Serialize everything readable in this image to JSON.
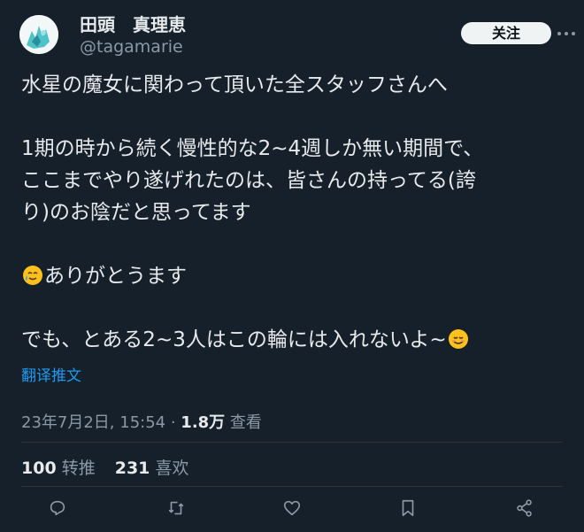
{
  "author": {
    "display_name": "田頭　真理恵",
    "handle": "@tagamarie"
  },
  "follow_label": "关注",
  "tweet": {
    "lines": [
      "水星の魔女に関わって頂いた全スタッフさんへ",
      "",
      "1期の時から続く慢性的な2~4週しか無い期間で、",
      "ここまでやり遂げれたのは、皆さんの持ってる(誇",
      "り)のお陰だと思ってます",
      "",
      "ありがとうます",
      "",
      "でも、とある2~3人はこの輪には入れないよ~"
    ],
    "emoji_line6": "smiling-face-with-tear-emoji",
    "emoji_line8": "smiling-face-emoji"
  },
  "translate_label": "翻译推文",
  "meta": {
    "date": "23年7月2日, 15:54 · ",
    "views_count": "1.8万",
    "views_label": " 查看"
  },
  "stats": {
    "retweets_count": "100",
    "retweets_label": "转推",
    "likes_count": "231",
    "likes_label": "喜欢"
  },
  "icons": {
    "reply": "reply-icon",
    "retweet": "retweet-icon",
    "like": "like-icon",
    "bookmark": "bookmark-icon",
    "share": "share-icon",
    "more": "more-icon"
  },
  "colors": {
    "background": "#15202b",
    "text": "#e7e9ea",
    "muted": "#8b98a5",
    "link": "#1d9bf0",
    "button_bg": "#eff3f4"
  }
}
